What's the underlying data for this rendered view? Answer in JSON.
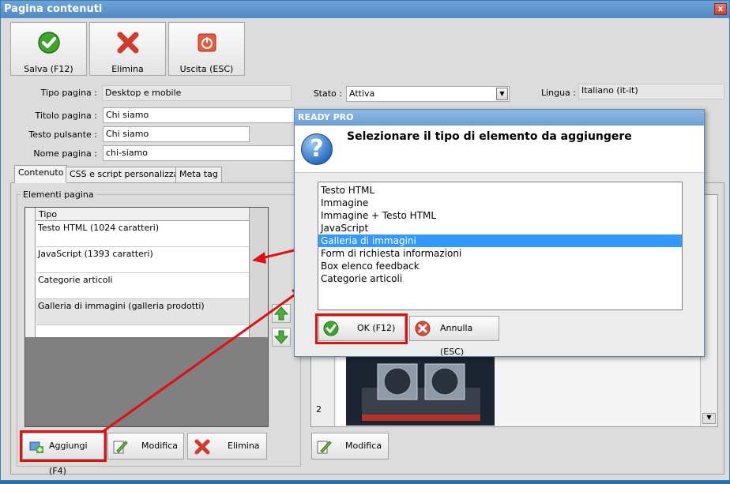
{
  "window": {
    "title": "Pagina contenuti",
    "close_glyph": "x"
  },
  "toolbar": {
    "save_label": "Salva (F12)",
    "delete_label": "Elimina",
    "exit_label": "Uscita (ESC)"
  },
  "form": {
    "page_type_label": "Tipo pagina :",
    "page_type_value": "Desktop e mobile",
    "state_label": "Stato :",
    "state_value": "Attiva",
    "language_label": "Lingua :",
    "language_value": "Italiano (it-it)",
    "title_label": "Titolo pagina :",
    "title_value": "Chi siamo",
    "button_text_label": "Testo pulsante :",
    "button_text_value": "Chi siamo",
    "page_name_label": "Nome pagina :",
    "page_name_value": "chi-siamo"
  },
  "tabs": [
    {
      "label": "Contenuto"
    },
    {
      "label": "CSS e script personalizzati"
    },
    {
      "label": "Meta tag"
    }
  ],
  "elements": {
    "group_label": "Elementi pagina",
    "column_header": "Tipo",
    "rows": [
      "Testo HTML (1024 caratteri)",
      "JavaScript (1393 caratteri)",
      "Categorie articoli",
      "Galleria di immagini (galleria prodotti)"
    ],
    "add_label": "Aggiungi (F4)",
    "edit_label": "Modifica",
    "delete_label": "Elimina"
  },
  "right_panel": {
    "row_number": "2",
    "edit_label": "Modifica"
  },
  "dialog": {
    "title": "READY PRO",
    "message": "Selezionare il tipo di elemento da aggiungere",
    "items": [
      "Testo HTML",
      "Immagine",
      "Immagine + Testo HTML",
      "JavaScript",
      "Galleria di immagini",
      "Form di richiesta informazioni",
      "Box elenco feedback",
      "Categorie articoli"
    ],
    "selected_index": 4,
    "ok_label": "OK (F12)",
    "cancel_label": "Annulla (ESC)"
  },
  "colors": {
    "annotation_red": "#e01010",
    "selection_blue": "#3399ff"
  }
}
